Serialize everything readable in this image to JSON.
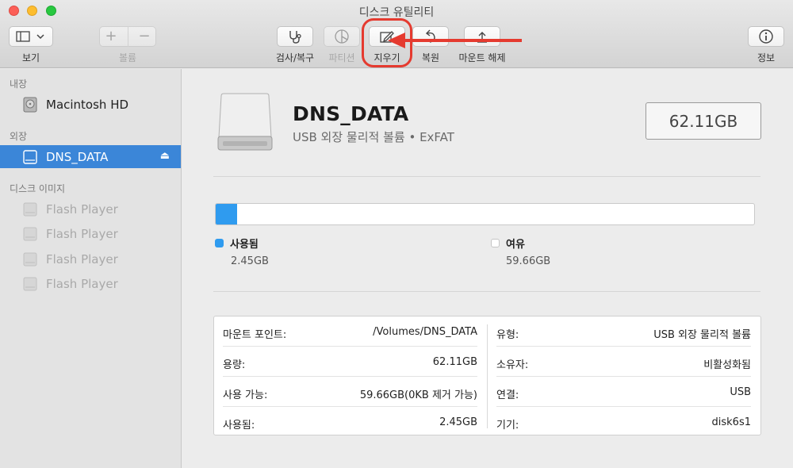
{
  "window": {
    "title": "디스크 유틸리티"
  },
  "toolbar": {
    "view_label": "보기",
    "volume_label": "볼륨",
    "firstaid_label": "검사/복구",
    "partition_label": "파티션",
    "erase_label": "지우기",
    "restore_label": "복원",
    "unmount_label": "마운트 해제",
    "info_label": "정보"
  },
  "sidebar": {
    "section_internal": "내장",
    "section_external": "외장",
    "section_images": "디스크 이미지",
    "internal_items": [
      {
        "label": "Macintosh HD"
      }
    ],
    "external_items": [
      {
        "label": "DNS_DATA",
        "selected": true
      }
    ],
    "image_items": [
      {
        "label": "Flash Player"
      },
      {
        "label": "Flash Player"
      },
      {
        "label": "Flash Player"
      },
      {
        "label": "Flash Player"
      }
    ]
  },
  "disk": {
    "name": "DNS_DATA",
    "subtitle": "USB 외장 물리적 볼륨 • ExFAT",
    "capacity": "62.11GB"
  },
  "usage": {
    "used_fraction": 0.04,
    "used_label": "사용됨",
    "used_value": "2.45GB",
    "free_label": "여유",
    "free_value": "59.66GB",
    "used_color": "#2f9bef",
    "free_color": "#ffffff"
  },
  "info": {
    "left": [
      {
        "key": "마운트 포인트:",
        "value": "/Volumes/DNS_DATA"
      },
      {
        "key": "용량:",
        "value": "62.11GB"
      },
      {
        "key": "사용 가능:",
        "value": "59.66GB(0KB 제거 가능)"
      },
      {
        "key": "사용됨:",
        "value": "2.45GB"
      }
    ],
    "right": [
      {
        "key": "유형:",
        "value": "USB 외장 물리적 볼륨"
      },
      {
        "key": "소유자:",
        "value": "비활성화됨"
      },
      {
        "key": "연결:",
        "value": "USB"
      },
      {
        "key": "기기:",
        "value": "disk6s1"
      }
    ]
  },
  "annotation": {
    "color": "#e53a2f"
  }
}
